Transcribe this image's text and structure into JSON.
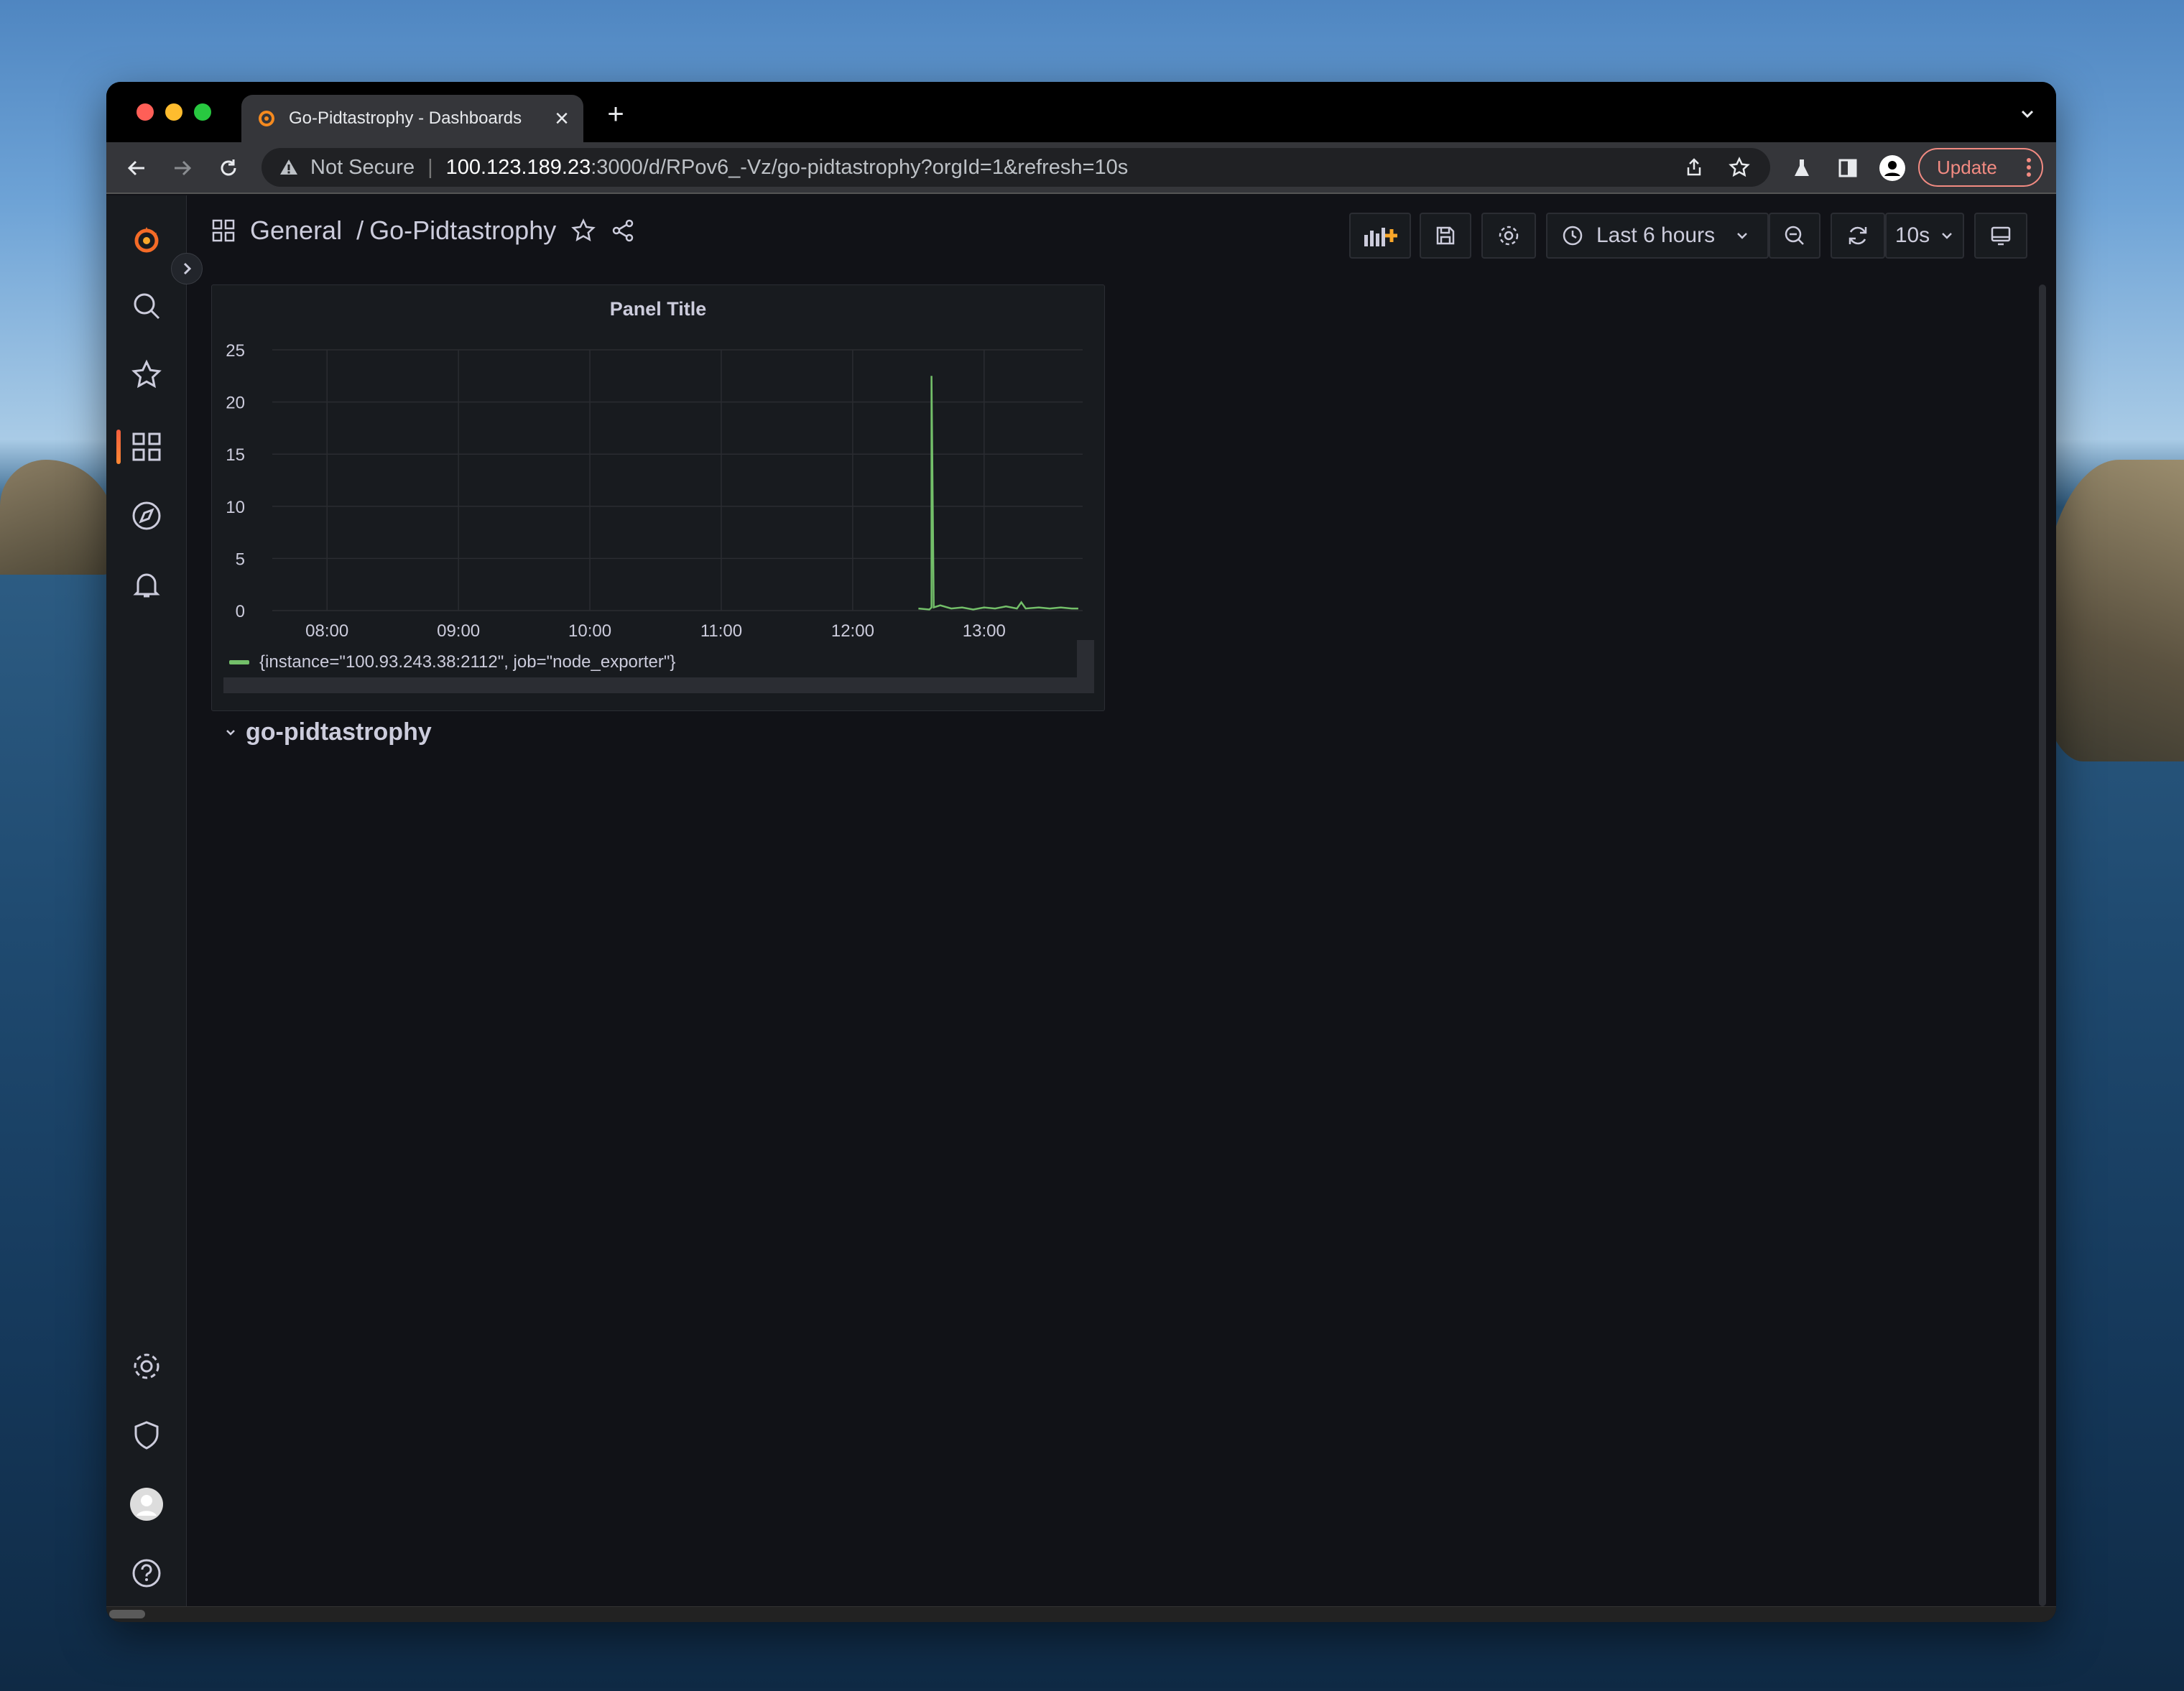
{
  "browser": {
    "tab_title": "Go-Pidtastrophy - Dashboards",
    "tab_close": "×",
    "new_tab": "+",
    "security_label": "Not Secure",
    "url_host": "100.123.189.23",
    "url_path": ":3000/d/RPov6_-Vz/go-pidtastrophy?orgId=1&refresh=10s",
    "update_label": "Update"
  },
  "dashboard": {
    "folder": "General",
    "separator": "/",
    "title": "Go-Pidtastrophy",
    "time_range": "Last 6 hours",
    "refresh_interval": "10s",
    "row_title": "go-pidtastrophy"
  },
  "colors": {
    "series": "#73bf69",
    "accent": "#f55f3e",
    "update": "#f28b82"
  },
  "chart_data": {
    "type": "line",
    "title": "Panel Title",
    "x_ticks": [
      "08:00",
      "09:00",
      "10:00",
      "11:00",
      "12:00",
      "13:00"
    ],
    "y_ticks": [
      "0",
      "5",
      "10",
      "15",
      "20",
      "25"
    ],
    "ylim": [
      0,
      25
    ],
    "xlim": [
      "07:35",
      "13:45"
    ],
    "grid": true,
    "legend_position": "bottom",
    "series": [
      {
        "name": "{instance=\"100.93.243.38:2112\", job=\"node_exporter\"}",
        "color": "#73bf69",
        "points": [
          [
            "12:30",
            0.2
          ],
          [
            "12:35",
            0.1
          ],
          [
            "12:36",
            0.3
          ],
          [
            "12:36",
            22.5
          ],
          [
            "12:37",
            0.3
          ],
          [
            "12:40",
            0.5
          ],
          [
            "12:45",
            0.2
          ],
          [
            "12:50",
            0.3
          ],
          [
            "12:55",
            0.1
          ],
          [
            "13:00",
            0.3
          ],
          [
            "13:05",
            0.2
          ],
          [
            "13:10",
            0.4
          ],
          [
            "13:15",
            0.2
          ],
          [
            "13:17",
            0.8
          ],
          [
            "13:19",
            0.2
          ],
          [
            "13:25",
            0.3
          ],
          [
            "13:30",
            0.2
          ],
          [
            "13:35",
            0.3
          ],
          [
            "13:40",
            0.2
          ],
          [
            "13:43",
            0.2
          ]
        ]
      }
    ]
  }
}
